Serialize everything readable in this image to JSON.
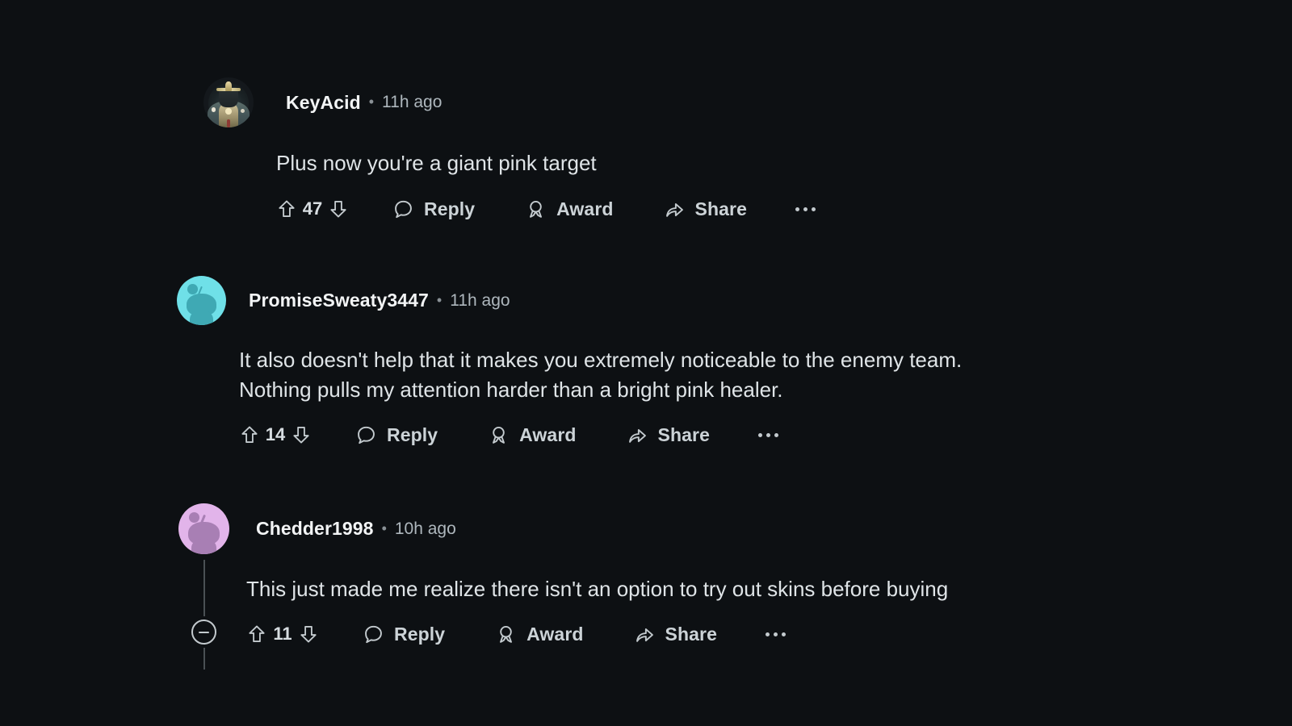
{
  "theme": {
    "background": "#0d1013",
    "author_color": "#f2f4f5",
    "timestamp_color": "#aeb7bd",
    "body_color": "#dfe4e7",
    "action_color": "#c3cace",
    "thread_line_color": "#4a5054"
  },
  "action_labels": {
    "reply": "Reply",
    "award": "Award",
    "share": "Share",
    "more": "more-options"
  },
  "icons": {
    "upvote": "upvote-arrow-icon",
    "downvote": "downvote-arrow-icon",
    "reply": "speech-bubble-icon",
    "award": "medal-ribbon-icon",
    "share": "share-arrow-icon",
    "more": "overflow-dots-icon",
    "collapse": "collapse-minus-icon"
  },
  "comments": [
    {
      "id": "comment-keyacid",
      "author": "KeyAcid",
      "separator": "•",
      "timestamp": "11h ago",
      "body": "Plus now you're a giant pink target",
      "score": "47",
      "avatar_type": "game-character",
      "avatar_colors": {
        "primary": "#4a5a5c",
        "accent": "#cfc39a",
        "background": "#14181c"
      }
    },
    {
      "id": "comment-promisesweaty3447",
      "author": "PromiseSweaty3447",
      "separator": "•",
      "timestamp": "11h ago",
      "body": "It also doesn't help that it makes you extremely noticeable to the enemy team.\nNothing pulls my attention harder than a bright pink healer.",
      "score": "14",
      "avatar_type": "snoo",
      "avatar_colors": {
        "circle": "#6fe0e8",
        "figure": "#3fa9b4"
      }
    },
    {
      "id": "comment-chedder1998",
      "author": "Chedder1998",
      "separator": "•",
      "timestamp": "10h ago",
      "body": "This just made me realize there isn't an option to try out skins before buying",
      "score": "11",
      "avatar_type": "snoo",
      "avatar_colors": {
        "circle": "#e2b4ea",
        "figure": "#a87fb4"
      },
      "has_collapse_control": true
    }
  ]
}
